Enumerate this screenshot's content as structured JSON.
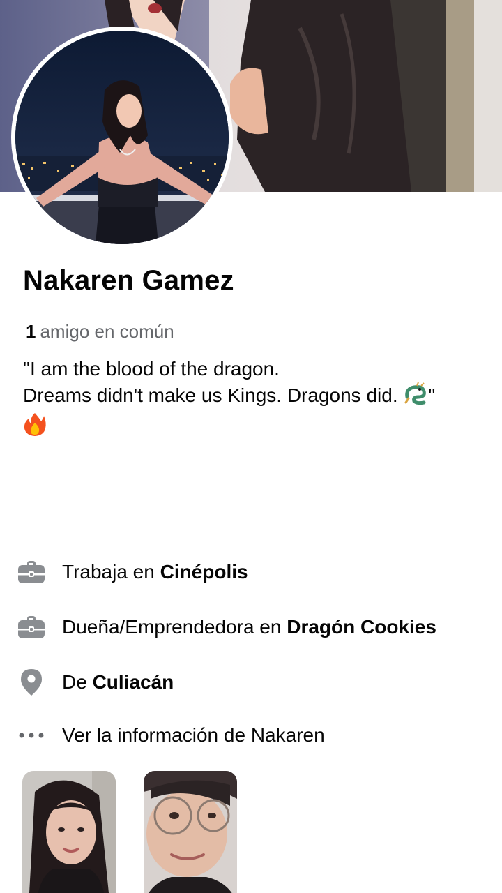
{
  "profile": {
    "name": "Nakaren Gamez",
    "mutual_count": "1",
    "mutual_label": "amigo en común",
    "bio_line1": "\"I am the blood of the dragon.",
    "bio_line2": "Dreams didn't make us Kings. Dragons did.",
    "bio_line2_end": "\"",
    "bio_emoji_dragon": "dragon-emoji",
    "bio_emoji_fire": "fire-emoji"
  },
  "info": {
    "work1_prefix": "Trabaja en",
    "work1_place": "Cinépolis",
    "work2_prefix": "Dueña/Emprendedora en",
    "work2_place": "Dragón Cookies",
    "from_prefix": "De",
    "from_place": "Culiacán",
    "see_info": "Ver la información de Nakaren"
  },
  "icons": {
    "work": "briefcase-icon",
    "location": "location-pin-icon",
    "more": "more-dots-icon"
  },
  "colors": {
    "icon_gray": "#8a8d91",
    "secondary_text": "#65676b",
    "divider": "#d6d8dc"
  }
}
